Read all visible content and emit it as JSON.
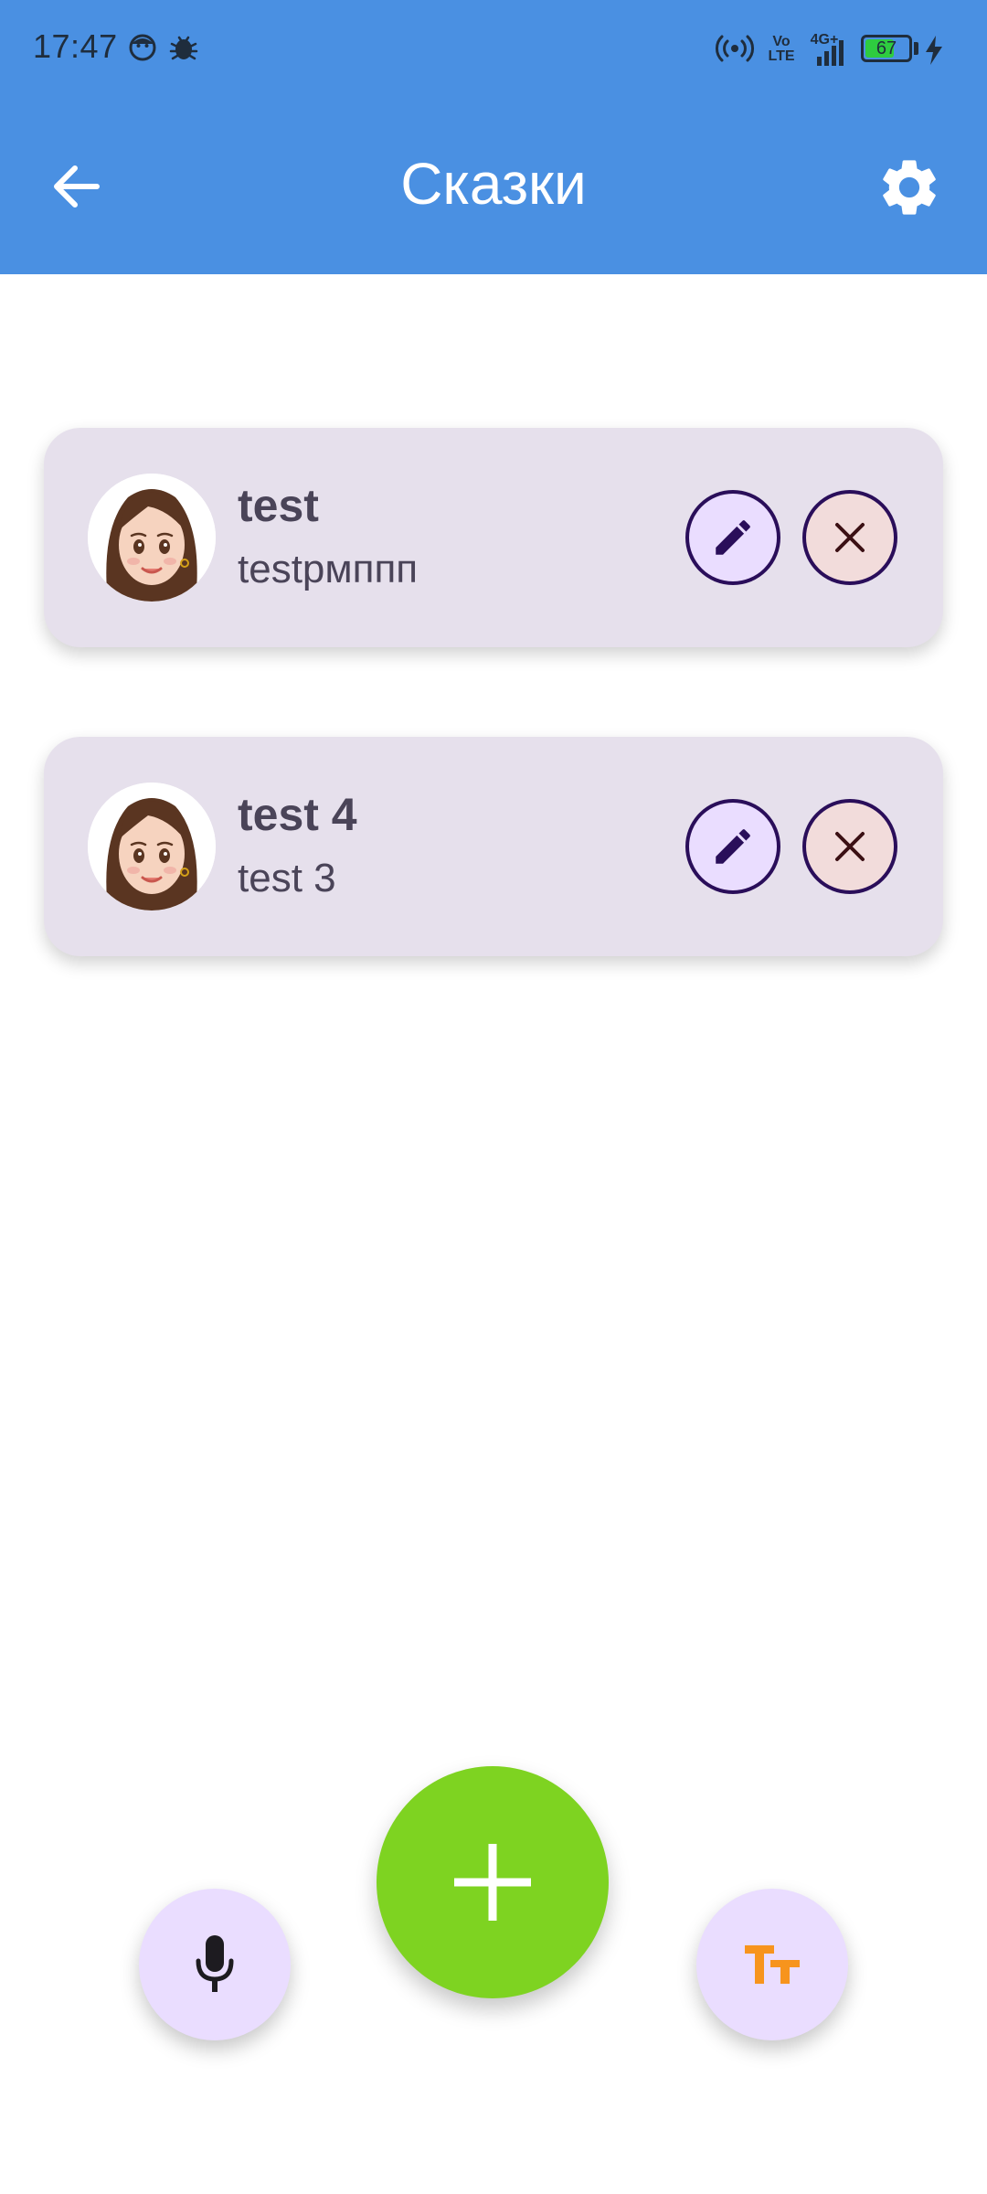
{
  "status_bar": {
    "time": "17:47",
    "network_volte_top": "Vo",
    "network_volte_bottom": "LTE",
    "network_type": "4G+",
    "battery_level": "67",
    "icons": [
      "face-icon",
      "bug-icon",
      "hotspot-icon",
      "signal-icon",
      "battery-icon",
      "charging-icon"
    ]
  },
  "header": {
    "title": "Сказки",
    "back_icon": "arrow-left-icon",
    "settings_icon": "gear-icon"
  },
  "tales": [
    {
      "title": "test",
      "subtitle": "testрмппп",
      "avatar": "girl-avatar"
    },
    {
      "title": "test 4",
      "subtitle": "test 3",
      "avatar": "girl-avatar"
    }
  ],
  "fabs": {
    "add_icon": "plus-icon",
    "mic_icon": "microphone-icon",
    "text_icon": "text-size-icon"
  },
  "colors": {
    "appbar": "#4A90E2",
    "card_bg": "#E6E0EC",
    "add_fab": "#7ED321",
    "small_fab": "#EADDFF",
    "text_icon_orange": "#F7941D",
    "button_border": "#2A0E5A"
  }
}
